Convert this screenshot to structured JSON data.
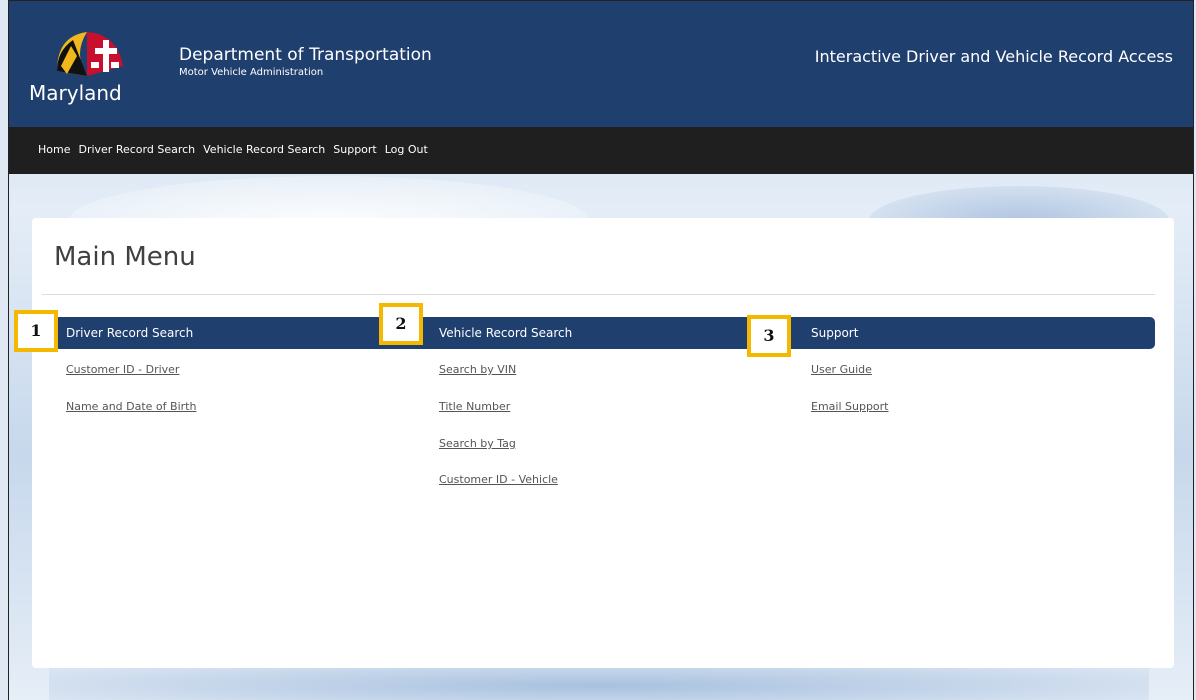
{
  "header": {
    "logo_text": "Maryland",
    "department": "Department of Transportation",
    "subdepartment": "Motor Vehicle Administration",
    "app_title": "Interactive Driver and Vehicle Record Access"
  },
  "nav": {
    "items": [
      "Home",
      "Driver Record Search",
      "Vehicle Record Search",
      "Support",
      "Log Out"
    ]
  },
  "main": {
    "title": "Main Menu",
    "columns": [
      {
        "header": "Driver Record Search",
        "marker": "1",
        "links": [
          "Customer ID - Driver",
          "Name and Date of Birth"
        ]
      },
      {
        "header": "Vehicle Record Search",
        "marker": "2",
        "links": [
          "Search by VIN",
          "Title Number",
          "Search by Tag",
          "Customer ID - Vehicle"
        ]
      },
      {
        "header": "Support",
        "marker": "3",
        "links": [
          "User Guide",
          "Email Support"
        ]
      }
    ]
  },
  "colors": {
    "header_bg": "#1f3f6e",
    "nav_bg": "#1f1f1f",
    "marker_border": "#f5b800"
  }
}
